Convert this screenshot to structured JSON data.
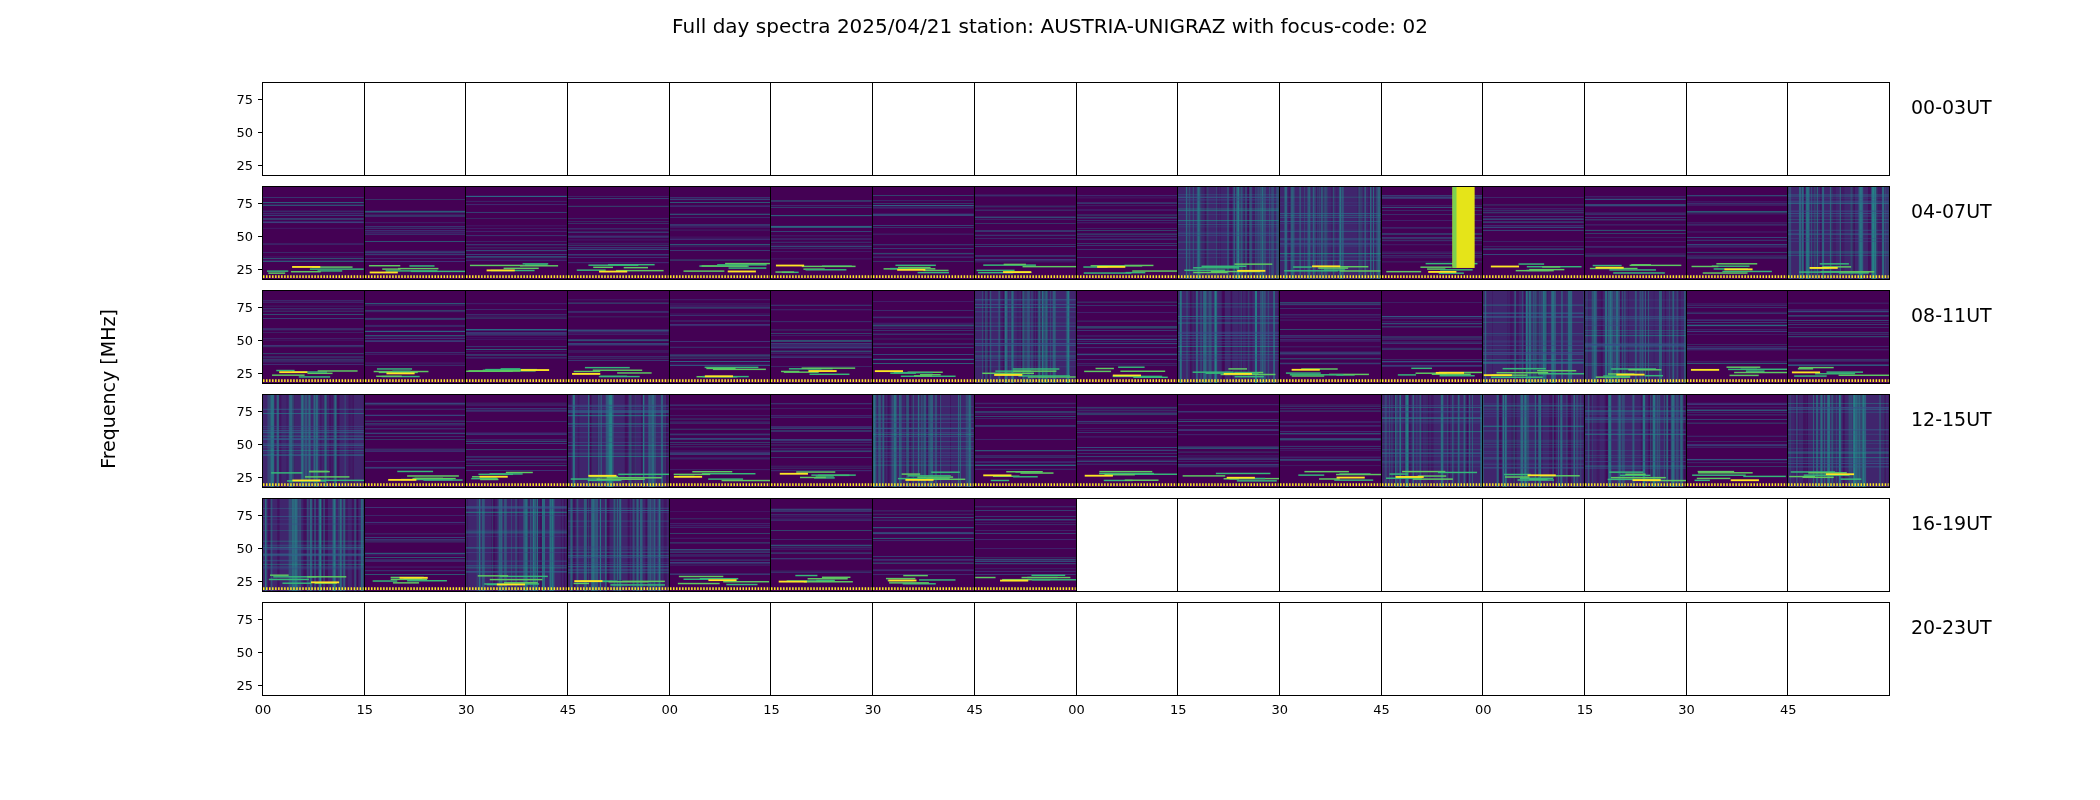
{
  "title": "Full day spectra 2025/04/21 station: AUSTRIA-UNIGRAZ with focus-code: 02",
  "y_label": "Frequency [MHz]",
  "rows": [
    {
      "label": "00-03UT",
      "y_ticks": [
        "75",
        "50",
        "25"
      ],
      "panels": [
        {
          "kind": "empty"
        },
        {
          "kind": "empty"
        },
        {
          "kind": "empty"
        },
        {
          "kind": "empty"
        },
        {
          "kind": "empty"
        },
        {
          "kind": "empty"
        },
        {
          "kind": "empty"
        },
        {
          "kind": "empty"
        },
        {
          "kind": "empty"
        },
        {
          "kind": "empty"
        },
        {
          "kind": "empty"
        },
        {
          "kind": "empty"
        },
        {
          "kind": "empty"
        },
        {
          "kind": "empty"
        },
        {
          "kind": "empty"
        },
        {
          "kind": "empty"
        }
      ]
    },
    {
      "label": "04-07UT",
      "y_ticks": [
        "75",
        "50",
        "25"
      ],
      "panels": [
        {
          "kind": "quiet"
        },
        {
          "kind": "quiet"
        },
        {
          "kind": "quiet"
        },
        {
          "kind": "quiet"
        },
        {
          "kind": "quiet"
        },
        {
          "kind": "quiet"
        },
        {
          "kind": "quiet"
        },
        {
          "kind": "quiet"
        },
        {
          "kind": "quiet"
        },
        {
          "kind": "busy"
        },
        {
          "kind": "busy"
        },
        {
          "kind": "burst"
        },
        {
          "kind": "quiet"
        },
        {
          "kind": "quiet"
        },
        {
          "kind": "quiet"
        },
        {
          "kind": "busy"
        }
      ]
    },
    {
      "label": "08-11UT",
      "y_ticks": [
        "75",
        "50",
        "25"
      ],
      "panels": [
        {
          "kind": "quiet"
        },
        {
          "kind": "quiet"
        },
        {
          "kind": "quiet"
        },
        {
          "kind": "quiet"
        },
        {
          "kind": "quiet"
        },
        {
          "kind": "quiet"
        },
        {
          "kind": "quiet"
        },
        {
          "kind": "busy"
        },
        {
          "kind": "quiet"
        },
        {
          "kind": "busy"
        },
        {
          "kind": "quiet"
        },
        {
          "kind": "quiet"
        },
        {
          "kind": "busy"
        },
        {
          "kind": "busy"
        },
        {
          "kind": "quiet"
        },
        {
          "kind": "quiet"
        }
      ]
    },
    {
      "label": "12-15UT",
      "y_ticks": [
        "75",
        "50",
        "25"
      ],
      "panels": [
        {
          "kind": "busy"
        },
        {
          "kind": "quiet"
        },
        {
          "kind": "quiet"
        },
        {
          "kind": "busy"
        },
        {
          "kind": "quiet"
        },
        {
          "kind": "quiet"
        },
        {
          "kind": "busy"
        },
        {
          "kind": "quiet"
        },
        {
          "kind": "quiet"
        },
        {
          "kind": "quiet"
        },
        {
          "kind": "quiet"
        },
        {
          "kind": "busy"
        },
        {
          "kind": "busy"
        },
        {
          "kind": "busy"
        },
        {
          "kind": "quiet"
        },
        {
          "kind": "busy"
        }
      ]
    },
    {
      "label": "16-19UT",
      "y_ticks": [
        "75",
        "50",
        "25"
      ],
      "panels": [
        {
          "kind": "busy"
        },
        {
          "kind": "quiet"
        },
        {
          "kind": "busy"
        },
        {
          "kind": "busy"
        },
        {
          "kind": "quiet"
        },
        {
          "kind": "quiet"
        },
        {
          "kind": "quiet"
        },
        {
          "kind": "quiet"
        },
        {
          "kind": "empty"
        },
        {
          "kind": "empty"
        },
        {
          "kind": "empty"
        },
        {
          "kind": "empty"
        },
        {
          "kind": "empty"
        },
        {
          "kind": "empty"
        },
        {
          "kind": "empty"
        },
        {
          "kind": "empty"
        }
      ]
    },
    {
      "label": "20-23UT",
      "y_ticks": [
        "75",
        "50",
        "25"
      ],
      "panels": [
        {
          "kind": "empty"
        },
        {
          "kind": "empty"
        },
        {
          "kind": "empty"
        },
        {
          "kind": "empty"
        },
        {
          "kind": "empty"
        },
        {
          "kind": "empty"
        },
        {
          "kind": "empty"
        },
        {
          "kind": "empty"
        },
        {
          "kind": "empty"
        },
        {
          "kind": "empty"
        },
        {
          "kind": "empty"
        },
        {
          "kind": "empty"
        },
        {
          "kind": "empty"
        },
        {
          "kind": "empty"
        },
        {
          "kind": "empty"
        },
        {
          "kind": "empty"
        }
      ]
    }
  ],
  "x_ticks": [
    "00",
    "15",
    "30",
    "45",
    "00",
    "15",
    "30",
    "45",
    "00",
    "15",
    "30",
    "45",
    "00",
    "15",
    "30",
    "45"
  ]
}
